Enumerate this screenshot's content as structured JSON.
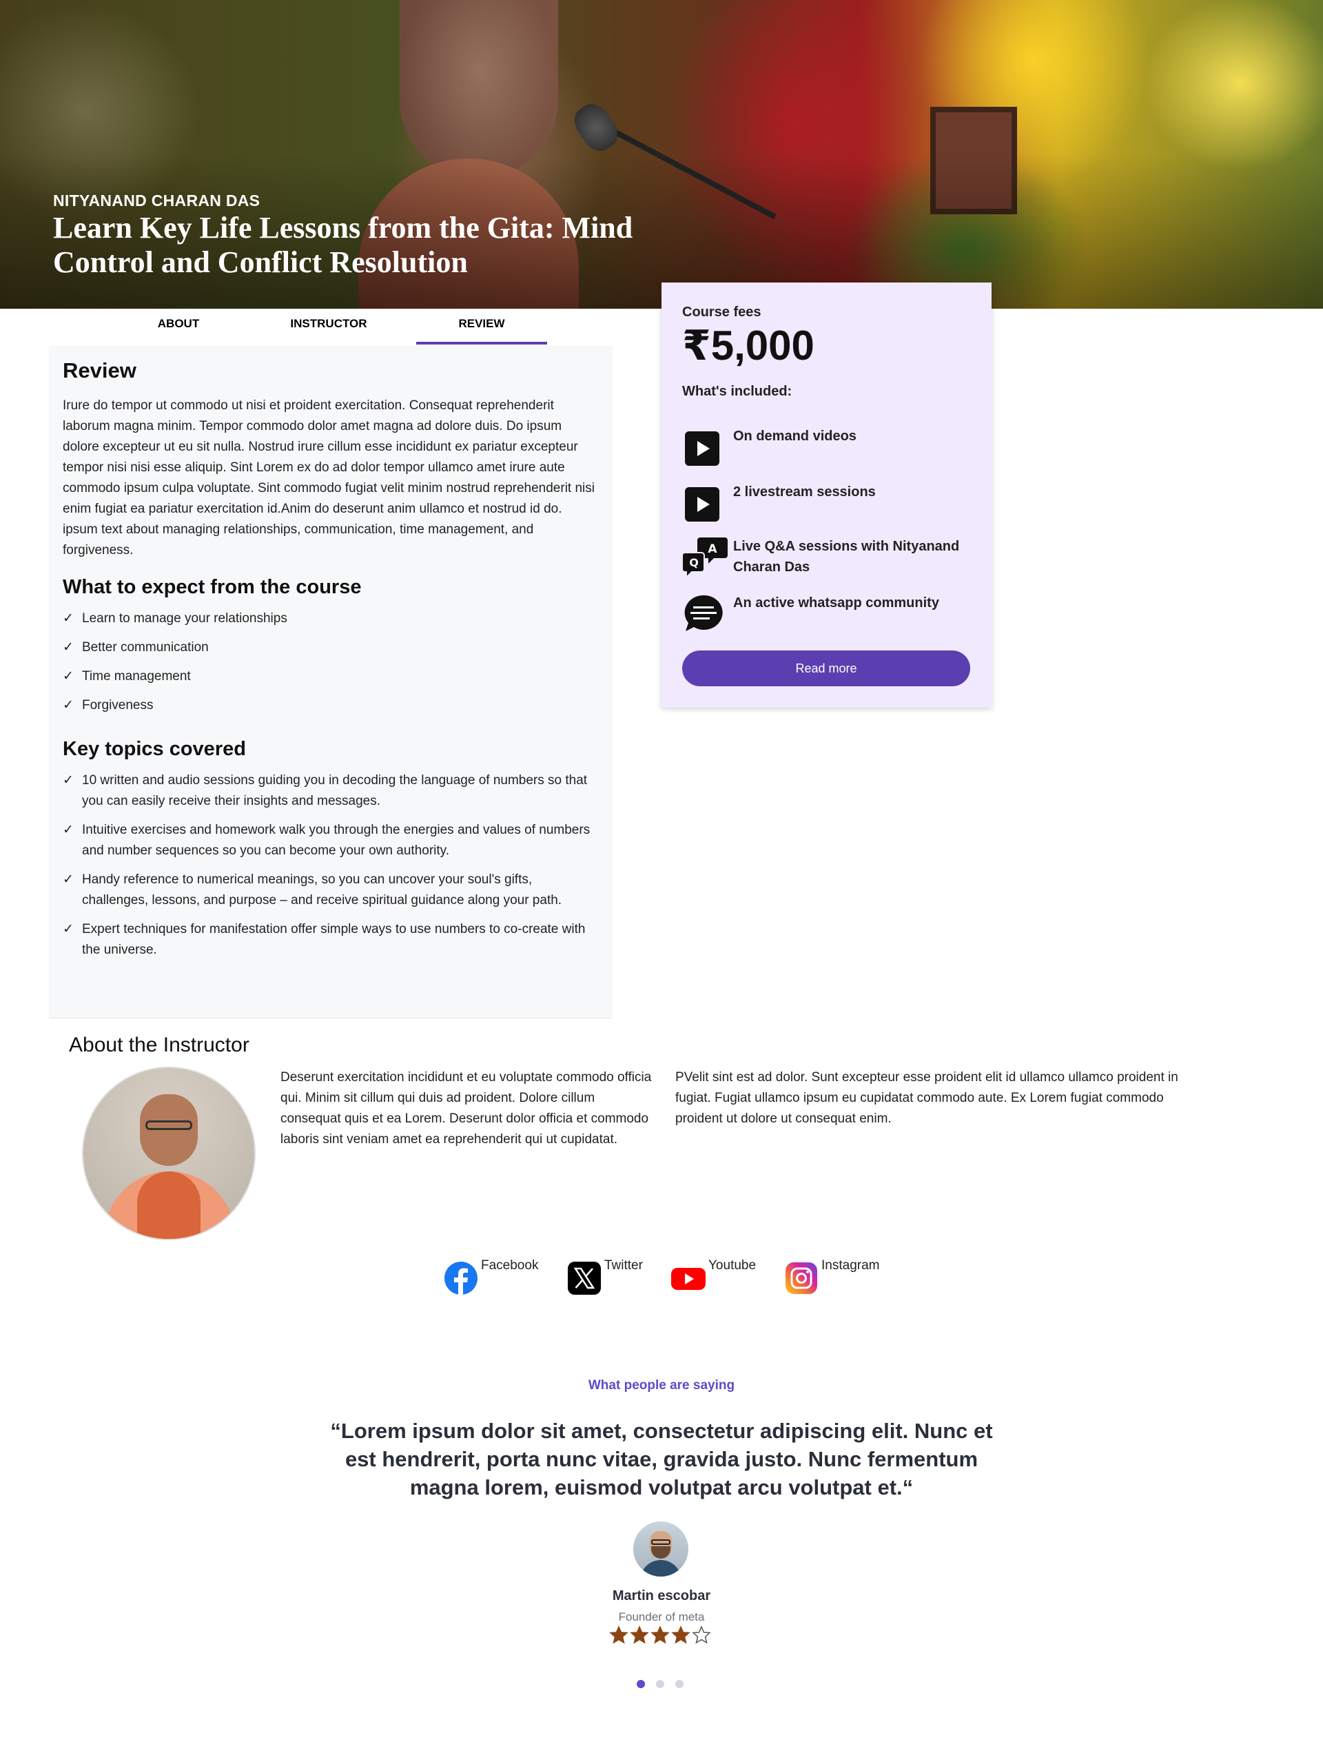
{
  "hero": {
    "author": "NITYANAND CHARAN DAS",
    "title": "Learn Key Life Lessons from the Gita: Mind Control and Conflict Resolution"
  },
  "tabs": [
    {
      "label": "ABOUT",
      "active": false
    },
    {
      "label": "INSTRUCTOR",
      "active": false
    },
    {
      "label": "REVIEW",
      "active": true
    }
  ],
  "review": {
    "heading": "Review",
    "body": "Irure do tempor ut commodo ut nisi et proident exercitation. Consequat reprehenderit laborum magna minim. Tempor commodo dolor amet magna ad dolore duis. Do ipsum dolore excepteur ut eu sit nulla. Nostrud irure cillum esse incididunt ex pariatur excepteur tempor nisi nisi esse aliquip. Sint Lorem ex do ad dolor tempor ullamco amet irure aute commodo ipsum culpa voluptate. Sint commodo fugiat velit minim nostrud reprehenderit nisi enim fugiat ea pariatur exercitation id.Anim do deserunt anim ullamco et nostrud id do. ipsum text about managing relationships, communication, time management, and forgiveness.",
    "expect_heading": "What to expect from the course",
    "expect_items": [
      "Learn to manage your relationships",
      "Better communication",
      "Time management",
      "Forgiveness"
    ],
    "topics_heading": "Key topics covered",
    "topics_items": [
      "10 written and audio sessions guiding you in decoding the language of numbers so that you can easily receive their insights and messages.",
      "Intuitive exercises and homework walk you through the energies and values of numbers and number sequences so you can become your own authority.",
      "Handy reference to numerical meanings, so you can uncover your soul's gifts, challenges, lessons, and purpose – and receive spiritual guidance along your path.",
      "Expert techniques for manifestation offer simple ways to use numbers to co-create with the universe."
    ],
    "check_glyph": "✓"
  },
  "fees": {
    "label": "Course fees",
    "price": "₹5,000",
    "included_label": "What's included:",
    "items": [
      {
        "icon": "play-icon",
        "text": "On demand videos"
      },
      {
        "icon": "play-icon",
        "text": "2 livestream sessions"
      },
      {
        "icon": "qa-chat-icon",
        "text": "Live Q&A sessions with Nityanand Charan Das"
      },
      {
        "icon": "chat-bubble-icon",
        "text": "An active whatsapp community"
      }
    ],
    "button_label": "Read more",
    "accent_color": "#5b3fb0",
    "card_color": "#f1e9fd"
  },
  "instructor": {
    "heading": "About the Instructor",
    "col1": "Deserunt exercitation incididunt et eu voluptate commodo officia qui. Minim sit cillum qui duis ad proident. Dolore cillum consequat quis et ea Lorem. Deserunt dolor officia et commodo laboris sint veniam amet ea reprehenderit qui ut cupidatat.",
    "col2": "PVelit sint est ad dolor. Sunt excepteur esse proident elit id ullamco ullamco proident in fugiat. Fugiat ullamco ipsum eu cupidatat commodo aute. Ex Lorem fugiat commodo proident ut dolore ut consequat enim."
  },
  "social": [
    {
      "icon": "facebook-icon",
      "label": "Facebook"
    },
    {
      "icon": "x-twitter-icon",
      "label": "Twitter"
    },
    {
      "icon": "youtube-icon",
      "label": "Youtube"
    },
    {
      "icon": "instagram-icon",
      "label": "Instagram"
    }
  ],
  "testimonial": {
    "section_label": "What people are saying",
    "quote": "“Lorem ipsum dolor sit amet, consectetur adipiscing elit. Nunc et est hendrerit, porta nunc vitae, gravida justo. Nunc fermentum magna lorem, euismod volutpat arcu volutpat et.“",
    "name": "Martin escobar",
    "role": "Founder of meta",
    "rating": 4,
    "rating_max": 5,
    "star_color": "#8b4513",
    "slides": 3,
    "active_slide": 0
  }
}
